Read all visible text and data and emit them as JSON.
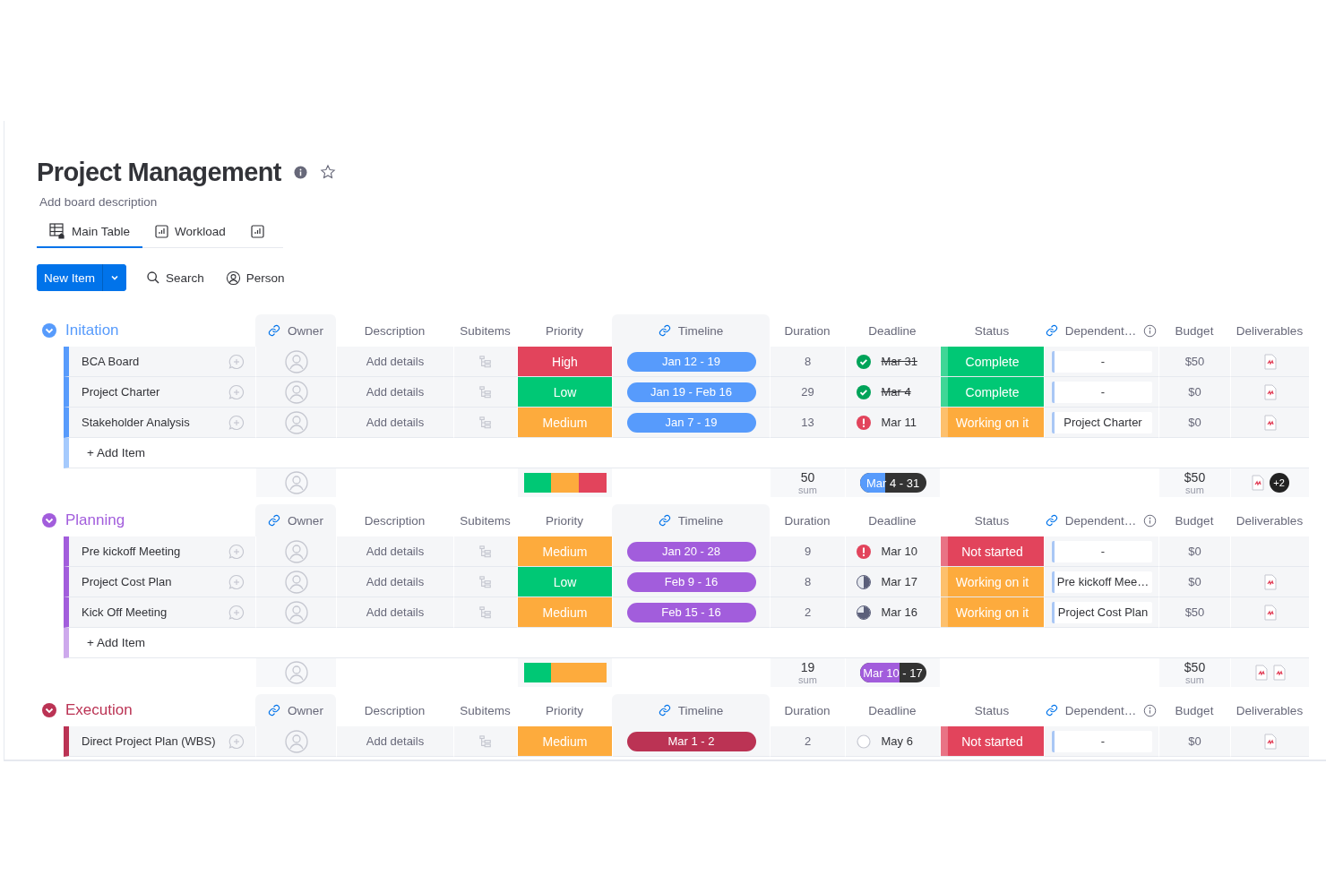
{
  "board": {
    "title": "Project Management",
    "description": "Add board description"
  },
  "tabs": [
    {
      "label": "Main Table",
      "kind": "table",
      "selected": true
    },
    {
      "label": "Workload",
      "kind": "chart",
      "selected": false
    },
    {
      "kind": "chart",
      "selected": false
    }
  ],
  "toolbar": {
    "new_item": "New Item",
    "search": "Search",
    "person": "Person"
  },
  "groups": [
    {
      "name": "Initation",
      "color": "#579bfc",
      "expanded": true,
      "columns": [
        {
          "label": "Owner",
          "kind": "linked"
        },
        {
          "label": "Description",
          "kind": "plain"
        },
        {
          "label": "Subitems",
          "kind": "plain"
        },
        {
          "label": "Priority",
          "kind": "plain"
        },
        {
          "label": "Timeline",
          "kind": "linked"
        },
        {
          "label": "Duration",
          "kind": "plain"
        },
        {
          "label": "Deadline",
          "kind": "plain"
        },
        {
          "label": "Status",
          "kind": "plain"
        },
        {
          "label": "Dependent…",
          "kind": "linked_info"
        },
        {
          "label": "Budget",
          "kind": "plain"
        },
        {
          "label": "Deliverables",
          "kind": "plain"
        }
      ],
      "rows": [
        {
          "name": "BCA Board",
          "description": "Add details",
          "priority": {
            "label": "High",
            "color": "#e2445c"
          },
          "timeline": "Jan 12 - 19",
          "duration": "8",
          "deadline": {
            "date": "Mar 31",
            "kind": "done"
          },
          "status": {
            "label": "Complete",
            "color": "#00c875"
          },
          "dependent": "-",
          "budget": "$50",
          "has_file": true
        },
        {
          "name": "Project Charter",
          "description": "Add details",
          "priority": {
            "label": "Low",
            "color": "#00c875"
          },
          "timeline": "Jan 19 - Feb 16",
          "duration": "29",
          "deadline": {
            "date": "Mar 4",
            "kind": "done"
          },
          "status": {
            "label": "Complete",
            "color": "#00c875"
          },
          "dependent": "-",
          "budget": "$0",
          "has_file": true
        },
        {
          "name": "Stakeholder Analysis",
          "description": "Add details",
          "priority": {
            "label": "Medium",
            "color": "#fdab3d"
          },
          "timeline": "Jan 7 - 19",
          "duration": "13",
          "deadline": {
            "date": "Mar 11",
            "kind": "overdue"
          },
          "status": {
            "label": "Working on it",
            "color": "#fdab3d"
          },
          "dependent": "Project Charter",
          "budget": "$0",
          "has_file": true
        }
      ],
      "add_item": "+ Add Item",
      "summary": {
        "priority": [
          {
            "color": "#00c875"
          },
          {
            "color": "#fdab3d"
          },
          {
            "color": "#e2445c"
          }
        ],
        "duration": "50",
        "duration_caption": "sum",
        "timeline": {
          "label": "Mar 4 - 31",
          "level": 0.38
        },
        "budget": "$50",
        "budget_caption": "sum",
        "files": [
          {
            "kind": "file"
          }
        ],
        "more": "+2"
      }
    },
    {
      "name": "Planning",
      "color": "#a25ddc",
      "expanded": true,
      "columns": [
        {
          "label": "Owner",
          "kind": "linked"
        },
        {
          "label": "Description",
          "kind": "plain"
        },
        {
          "label": "Subitems",
          "kind": "plain"
        },
        {
          "label": "Priority",
          "kind": "plain"
        },
        {
          "label": "Timeline",
          "kind": "linked"
        },
        {
          "label": "Duration",
          "kind": "plain"
        },
        {
          "label": "Deadline",
          "kind": "plain"
        },
        {
          "label": "Status",
          "kind": "plain"
        },
        {
          "label": "Dependent…",
          "kind": "linked_info"
        },
        {
          "label": "Budget",
          "kind": "plain"
        },
        {
          "label": "Deliverables",
          "kind": "plain"
        }
      ],
      "rows": [
        {
          "name": "Pre kickoff Meeting",
          "description": "Add details",
          "priority": {
            "label": "Medium",
            "color": "#fdab3d"
          },
          "timeline": "Jan 20 - 28",
          "duration": "9",
          "deadline": {
            "date": "Mar 10",
            "kind": "overdue"
          },
          "status": {
            "label": "Not started",
            "color": "#e2445c"
          },
          "dependent": "-",
          "budget": "$0",
          "has_file": false
        },
        {
          "name": "Project Cost Plan",
          "description": "Add details",
          "priority": {
            "label": "Low",
            "color": "#00c875"
          },
          "timeline": "Feb 9 - 16",
          "duration": "8",
          "deadline": {
            "date": "Mar 17",
            "kind": "half"
          },
          "status": {
            "label": "Working on it",
            "color": "#fdab3d"
          },
          "dependent": "Pre kickoff Mee…",
          "budget": "$0",
          "has_file": true
        },
        {
          "name": "Kick Off Meeting",
          "description": "Add details",
          "priority": {
            "label": "Medium",
            "color": "#fdab3d"
          },
          "timeline": "Feb 15 - 16",
          "duration": "2",
          "deadline": {
            "date": "Mar 16",
            "kind": "most"
          },
          "status": {
            "label": "Working on it",
            "color": "#fdab3d"
          },
          "dependent": "Project Cost Plan",
          "budget": "$50",
          "has_file": true
        }
      ],
      "add_item": "+ Add Item",
      "summary": {
        "priority": [
          {
            "color": "#00c875"
          },
          {
            "color": "#fdab3d"
          },
          {
            "color": "#fdab3d"
          }
        ],
        "duration": "19",
        "duration_caption": "sum",
        "timeline": {
          "label": "Mar 10 - 17",
          "level": 0.6
        },
        "budget": "$50",
        "budget_caption": "sum",
        "files": [
          {
            "kind": "file"
          },
          {
            "kind": "file"
          }
        ]
      }
    },
    {
      "name": "Execution",
      "color": "#bb3354",
      "expanded": true,
      "columns": [
        {
          "label": "Owner",
          "kind": "linked"
        },
        {
          "label": "Description",
          "kind": "plain"
        },
        {
          "label": "Subitems",
          "kind": "plain"
        },
        {
          "label": "Priority",
          "kind": "plain"
        },
        {
          "label": "Timeline",
          "kind": "linked"
        },
        {
          "label": "Duration",
          "kind": "plain"
        },
        {
          "label": "Deadline",
          "kind": "plain"
        },
        {
          "label": "Status",
          "kind": "plain"
        },
        {
          "label": "Dependent…",
          "kind": "linked_info"
        },
        {
          "label": "Budget",
          "kind": "plain"
        },
        {
          "label": "Deliverables",
          "kind": "plain"
        }
      ],
      "rows": [
        {
          "name": "Direct Project Plan (WBS)",
          "description": "Add details",
          "priority": {
            "label": "Medium",
            "color": "#fdab3d"
          },
          "timeline": "Mar 1 - 2",
          "duration": "2",
          "deadline": {
            "date": "May 6",
            "kind": "empty"
          },
          "status": {
            "label": "Not started",
            "color": "#e2445c"
          },
          "dependent": "-",
          "budget": "$0",
          "has_file": true
        }
      ]
    }
  ]
}
